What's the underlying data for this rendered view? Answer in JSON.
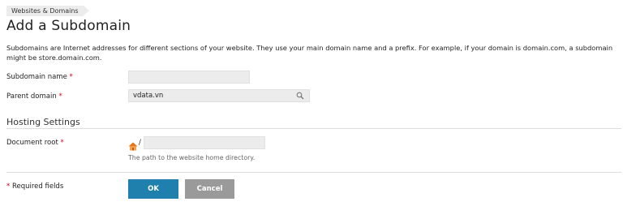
{
  "breadcrumb": {
    "items": [
      "Websites & Domains"
    ]
  },
  "page": {
    "title": "Add a Subdomain",
    "description": "Subdomains are Internet addresses for different sections of your website. They use your main domain name and a prefix. For example, if your domain is domain.com, a subdomain might be store.domain.com."
  },
  "form": {
    "subdomain_label": "Subdomain name",
    "subdomain_value": "",
    "parent_label": "Parent domain",
    "parent_value": "vdata.vn",
    "required_mark": "*"
  },
  "hosting": {
    "title": "Hosting Settings",
    "docroot_label": "Document root",
    "docroot_prefix": "/",
    "docroot_value": "",
    "docroot_hint": "The path to the website home directory."
  },
  "footer": {
    "required_text": "Required fields",
    "ok_label": "OK",
    "cancel_label": "Cancel"
  },
  "colors": {
    "ok_button": "#1f7fad",
    "cancel_button": "#9a9a9a",
    "required_asterisk": "#d0021b",
    "home_icon": "#e8731c"
  }
}
